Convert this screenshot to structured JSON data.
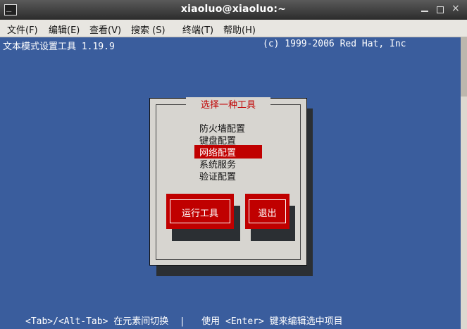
{
  "window": {
    "title": "xiaoluo@xiaoluo:~"
  },
  "menubar": {
    "items": [
      {
        "label": "文件(F)"
      },
      {
        "label": "编辑(E)"
      },
      {
        "label": "查看(V)"
      },
      {
        "label": "搜索 (S)"
      },
      {
        "label": "终端(T)"
      },
      {
        "label": "帮助(H)"
      }
    ]
  },
  "terminal": {
    "header_left": "文本模式设置工具 1.19.9",
    "header_right": "(c) 1999-2006 Red Hat, Inc",
    "footer": "<Tab>/<Alt-Tab> 在元素间切换  |   使用 <Enter> 键来编辑选中项目"
  },
  "dialog": {
    "title": "选择一种工具",
    "items": [
      {
        "label": "防火墙配置"
      },
      {
        "label": "键盘配置"
      },
      {
        "label": "网络配置"
      },
      {
        "label": "系统服务"
      },
      {
        "label": "验证配置"
      }
    ],
    "selected_index": 2,
    "buttons": {
      "run_label": "运行工具",
      "exit_label": "退出"
    }
  },
  "colors": {
    "terminal_bg": "#3a5d9d",
    "dialog_bg": "#d7d5d0",
    "accent_red": "#c00000",
    "shadow": "#2b2f33"
  },
  "icons": {
    "window": "terminal-icon",
    "minimize": "minimize-icon",
    "maximize": "maximize-icon",
    "close": "close-icon"
  }
}
